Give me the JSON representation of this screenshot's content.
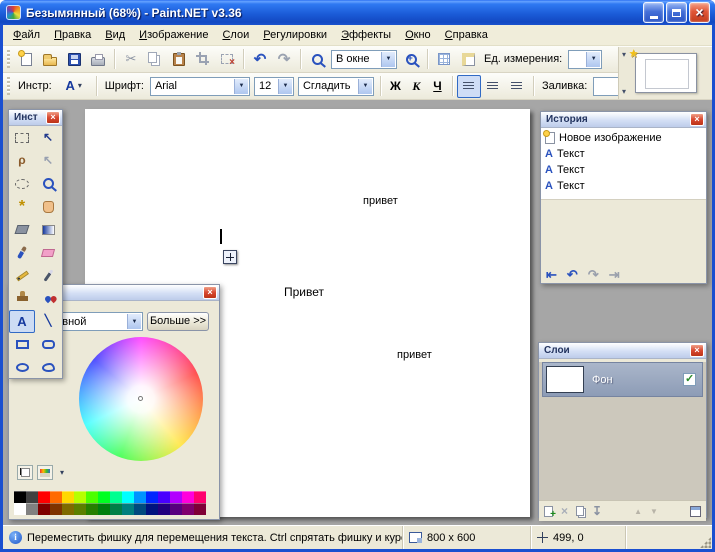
{
  "colors": {
    "titlebar_blue": "#1b5cd8",
    "window_face": "#ece9d8",
    "workspace_gray": "#a6a6a6",
    "selection_blue": "#316ac5",
    "close_button_red": "#d84830",
    "tool_accent_blue": "#2a52be"
  },
  "titlebar": {
    "title": "Безымянный (68%) - Paint.NET v3.36"
  },
  "menu": {
    "items": [
      "Файл",
      "Правка",
      "Вид",
      "Изображение",
      "Слои",
      "Регулировки",
      "Эффекты",
      "Окно",
      "Справка"
    ]
  },
  "toolbar": {
    "zoom_mode_value": "В окне",
    "units_label": "Ед. измерения:",
    "units_value": "",
    "buttons": [
      {
        "type": "button",
        "icon": "new-document"
      },
      {
        "type": "button",
        "icon": "open-folder"
      },
      {
        "type": "button",
        "icon": "save-disk"
      },
      {
        "type": "button",
        "icon": "print"
      },
      {
        "type": "sep"
      },
      {
        "type": "button",
        "icon": "cut-scissors",
        "disabled": true
      },
      {
        "type": "button",
        "icon": "copy",
        "disabled": true
      },
      {
        "type": "button",
        "icon": "paste"
      },
      {
        "type": "button",
        "icon": "crop",
        "disabled": true
      },
      {
        "type": "button",
        "icon": "deselect",
        "disabled": true
      },
      {
        "type": "sep"
      },
      {
        "type": "button",
        "icon": "undo-arrow"
      },
      {
        "type": "button",
        "icon": "redo-arrow",
        "disabled": true
      },
      {
        "type": "sep"
      },
      {
        "type": "button",
        "icon": "zoom-out-magnifier"
      },
      {
        "type": "combo",
        "name": "zoom-mode-combo",
        "value_key": "zoom_mode_value",
        "width": 66
      },
      {
        "type": "button",
        "icon": "zoom-in-magnifier"
      },
      {
        "type": "sep"
      },
      {
        "type": "button",
        "icon": "grid-toggle"
      },
      {
        "type": "button",
        "icon": "rulers-toggle"
      },
      {
        "type": "label",
        "name": "units-label",
        "value_key": "units_label"
      },
      {
        "type": "combo",
        "name": "units-combo",
        "value_key": "units_value",
        "width": 34
      }
    ]
  },
  "tool_options": {
    "tool_label": "Инстр:",
    "current_tool": "text",
    "font_label": "Шрифт:",
    "font_family_value": "Arial",
    "font_size_value": "12",
    "smoothing_value": "Сгладить",
    "bold_label": "Ж",
    "italic_label": "К",
    "underline_label": "Ч",
    "alignment_selected": "left",
    "fill_label": "Заливка:",
    "fill_value": ""
  },
  "image_list": {
    "unsaved_indicator_icon": "star-icon"
  },
  "tools_panel": {
    "title": "Инст",
    "tools": [
      {
        "name": "rectangle-select"
      },
      {
        "name": "move-selected-pixels"
      },
      {
        "name": "lasso-select"
      },
      {
        "name": "move-selection"
      },
      {
        "name": "ellipse-select"
      },
      {
        "name": "zoom"
      },
      {
        "name": "magic-wand"
      },
      {
        "name": "pan"
      },
      {
        "name": "paint-bucket"
      },
      {
        "name": "gradient"
      },
      {
        "name": "paintbrush"
      },
      {
        "name": "eraser"
      },
      {
        "name": "pencil"
      },
      {
        "name": "color-picker"
      },
      {
        "name": "clone-stamp"
      },
      {
        "name": "recolor"
      },
      {
        "name": "text",
        "selected": true
      },
      {
        "name": "line-curve"
      },
      {
        "name": "rectangle"
      },
      {
        "name": "rounded-rectangle"
      },
      {
        "name": "ellipse"
      },
      {
        "name": "freeform-shape"
      }
    ]
  },
  "colors_panel": {
    "title": "",
    "color_target_value": "Основной",
    "more_button": "Больше >>",
    "palette_row1": [
      "#000000",
      "#404040",
      "#ff0000",
      "#ff6a00",
      "#ffd800",
      "#b6ff00",
      "#4cff00",
      "#00ff21",
      "#00ff90",
      "#00ffff",
      "#0094ff",
      "#0026ff",
      "#4800ff",
      "#b200ff",
      "#ff00dc",
      "#ff006e"
    ],
    "palette_row2": [
      "#ffffff",
      "#808080",
      "#7f0000",
      "#7f3300",
      "#7f6a00",
      "#5b7f00",
      "#267f00",
      "#007f0e",
      "#007f46",
      "#007f7f",
      "#004a7f",
      "#00137f",
      "#21007f",
      "#57007f",
      "#7f006e",
      "#7f0037"
    ]
  },
  "history_panel": {
    "title": "История",
    "items": [
      {
        "icon": "new-image-icon",
        "label": "Новое изображение"
      },
      {
        "icon": "text-icon",
        "label": "Текст"
      },
      {
        "icon": "text-icon",
        "label": "Текст"
      },
      {
        "icon": "text-icon",
        "label": "Текст"
      }
    ]
  },
  "layers_panel": {
    "title": "Слои",
    "layers": [
      {
        "name": "Фон",
        "visible": true,
        "selected": true
      }
    ]
  },
  "canvas": {
    "texts": [
      {
        "value": "привет"
      },
      {
        "value": "Привет"
      },
      {
        "value": "привет"
      }
    ]
  },
  "statusbar": {
    "message": "Переместить фишку для перемещения текста. Ctrl спрятать фишку и курсор",
    "image_size": "800 x 600",
    "cursor_position": "499, 0"
  }
}
